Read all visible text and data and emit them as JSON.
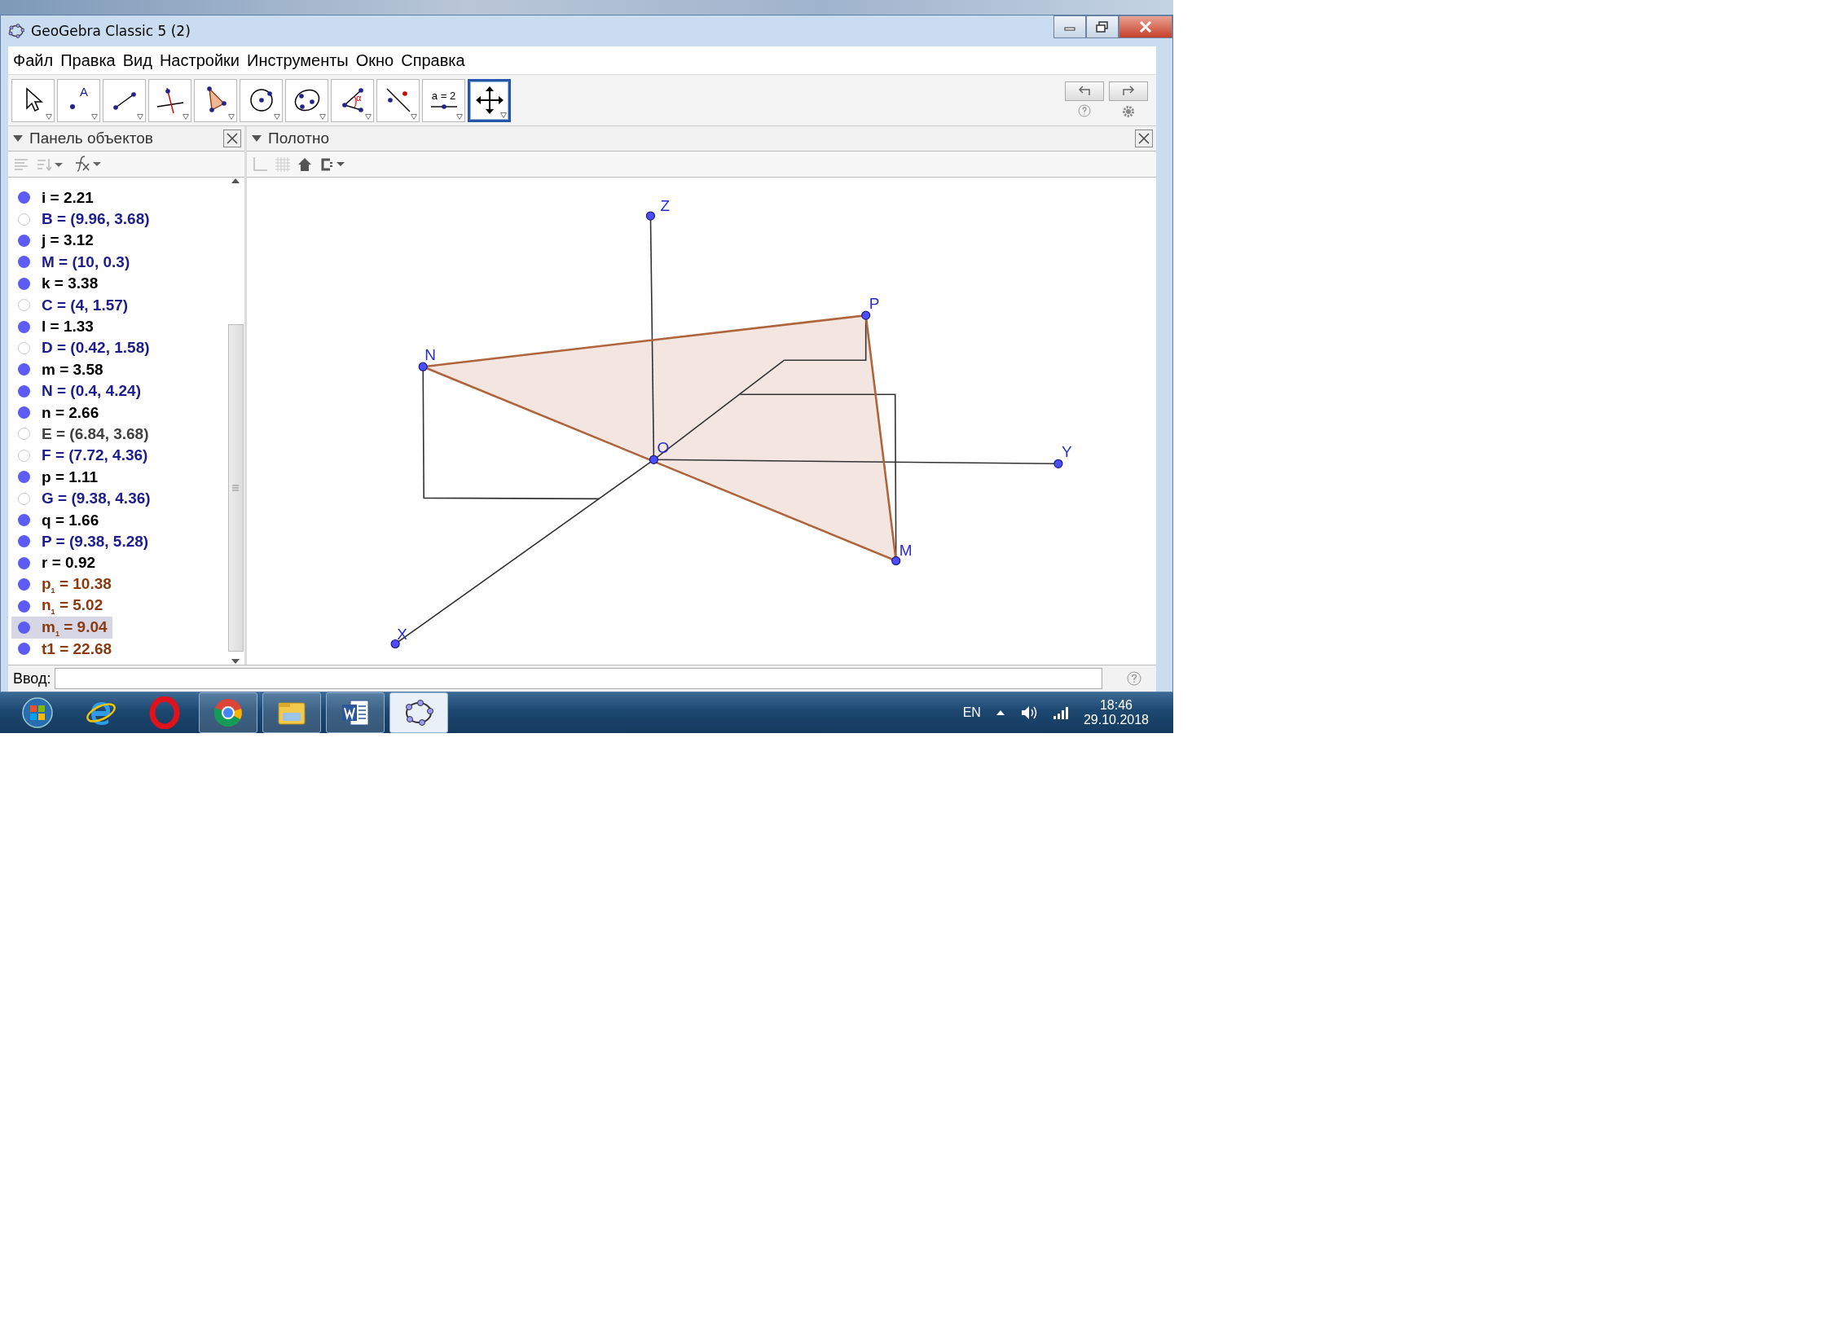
{
  "window": {
    "title": "GeoGebra Classic 5 (2)"
  },
  "menu": [
    "Файл",
    "Правка",
    "Вид",
    "Настройки",
    "Инструменты",
    "Окно",
    "Справка"
  ],
  "toolbar": {
    "tools": [
      {
        "kind": "move",
        "selected": false
      },
      {
        "kind": "point",
        "label": "A",
        "selected": false
      },
      {
        "kind": "segment",
        "selected": false
      },
      {
        "kind": "perpendicular",
        "selected": false
      },
      {
        "kind": "polygon",
        "selected": false
      },
      {
        "kind": "circle",
        "selected": false
      },
      {
        "kind": "conic",
        "selected": false
      },
      {
        "kind": "angle",
        "label": "α",
        "selected": false
      },
      {
        "kind": "reflect",
        "selected": false
      },
      {
        "kind": "slider",
        "label": "a = 2",
        "selected": false
      },
      {
        "kind": "pan",
        "selected": true
      }
    ]
  },
  "algebra_panel": {
    "title": "Панель объектов",
    "items": [
      {
        "text": "i = 2.21",
        "visible": true,
        "color": "#000000",
        "selected": false
      },
      {
        "text": "B = (9.96, 3.68)",
        "visible": false,
        "color": "#1c1c8c",
        "selected": false
      },
      {
        "text": "j = 3.12",
        "visible": true,
        "color": "#000000",
        "selected": false
      },
      {
        "text": "M = (10, 0.3)",
        "visible": true,
        "color": "#1c1c8c",
        "selected": false
      },
      {
        "text": "k = 3.38",
        "visible": true,
        "color": "#000000",
        "selected": false
      },
      {
        "text": "C = (4, 1.57)",
        "visible": false,
        "color": "#1c1c8c",
        "selected": false
      },
      {
        "text": "l = 1.33",
        "visible": true,
        "color": "#000000",
        "selected": false
      },
      {
        "text": "D = (0.42, 1.58)",
        "visible": false,
        "color": "#1c1c8c",
        "selected": false
      },
      {
        "text": "m = 3.58",
        "visible": true,
        "color": "#000000",
        "selected": false
      },
      {
        "text": "N = (0.4, 4.24)",
        "visible": true,
        "color": "#1c1c8c",
        "selected": false
      },
      {
        "text": "n = 2.66",
        "visible": true,
        "color": "#000000",
        "selected": false
      },
      {
        "text": "E = (6.84, 3.68)",
        "visible": false,
        "color": "#404040",
        "selected": false
      },
      {
        "text": "F = (7.72, 4.36)",
        "visible": false,
        "color": "#1c1c8c",
        "selected": false
      },
      {
        "text": "p = 1.11",
        "visible": true,
        "color": "#000000",
        "selected": false
      },
      {
        "text": "G = (9.38, 4.36)",
        "visible": false,
        "color": "#1c1c8c",
        "selected": false
      },
      {
        "text": "q = 1.66",
        "visible": true,
        "color": "#000000",
        "selected": false
      },
      {
        "text": "P = (9.38, 5.28)",
        "visible": true,
        "color": "#1c1c8c",
        "selected": false
      },
      {
        "text": "r = 0.92",
        "visible": true,
        "color": "#000000",
        "selected": false
      },
      {
        "text": "p$_{1}$ = 10.38",
        "visible": true,
        "color": "#8b3a0f",
        "selected": false
      },
      {
        "text": "n$_{1}$ = 5.02",
        "visible": true,
        "color": "#8b3a0f",
        "selected": false
      },
      {
        "text": "m$_{1}$ = 9.04",
        "visible": true,
        "color": "#8b3a0f",
        "selected": true
      },
      {
        "text": "t1 = 22.68",
        "visible": true,
        "color": "#8b3a0f",
        "selected": false
      }
    ]
  },
  "graphics_panel": {
    "title": "Полотно",
    "points": [
      {
        "label": "Z"
      },
      {
        "label": "N"
      },
      {
        "label": "P"
      },
      {
        "label": "O"
      },
      {
        "label": "Y"
      },
      {
        "label": "M"
      },
      {
        "label": "X"
      }
    ]
  },
  "input_bar": {
    "label": "Ввод:"
  },
  "taskbar": {
    "apps": [
      {
        "kind": "start",
        "open": false,
        "selected": false
      },
      {
        "kind": "ie",
        "open": false,
        "selected": false
      },
      {
        "kind": "opera",
        "open": false,
        "selected": false
      },
      {
        "kind": "chrome",
        "open": true,
        "selected": false
      },
      {
        "kind": "explorer",
        "open": true,
        "selected": false
      },
      {
        "kind": "word",
        "open": true,
        "selected": false
      },
      {
        "kind": "geogebra",
        "open": true,
        "selected": true
      }
    ],
    "language": "EN",
    "time": "18:46",
    "date": "29.10.2018"
  }
}
